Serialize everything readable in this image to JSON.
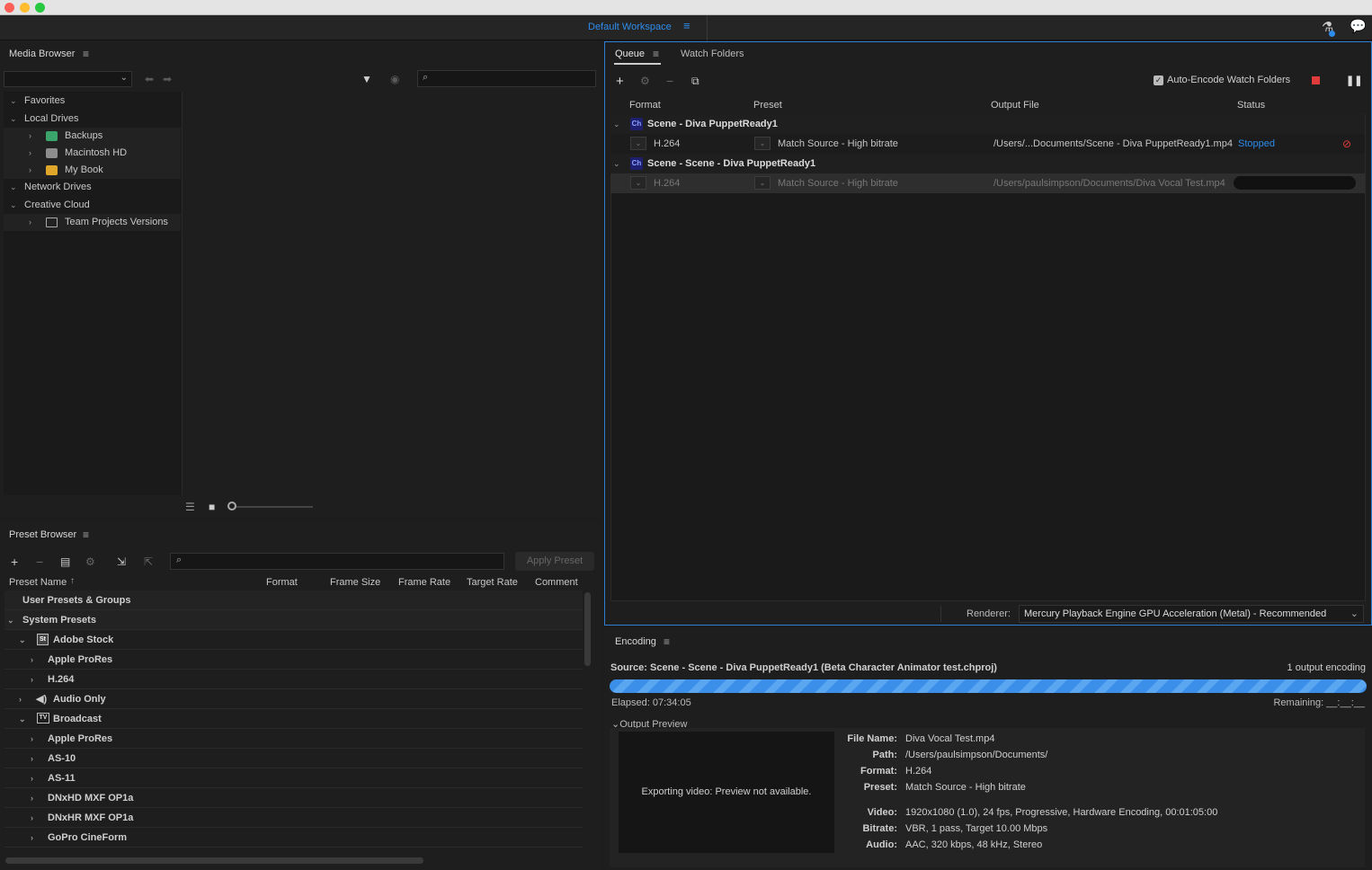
{
  "workspace": {
    "name": "Default Workspace"
  },
  "media_browser": {
    "title": "Media Browser",
    "tree": [
      {
        "label": "Favorites",
        "level": 0
      },
      {
        "label": "Local Drives",
        "level": 0
      },
      {
        "label": "Backups",
        "level": 1,
        "icon": "drive-green-icon"
      },
      {
        "label": "Macintosh HD",
        "level": 1,
        "icon": "drive-gray-icon"
      },
      {
        "label": "My Book",
        "level": 1,
        "icon": "drive-yellow-icon"
      },
      {
        "label": "Network Drives",
        "level": 0
      },
      {
        "label": "Creative Cloud",
        "level": 0
      },
      {
        "label": "Team Projects Versions",
        "level": 1,
        "icon": "team-projects-icon"
      }
    ]
  },
  "preset_browser": {
    "title": "Preset Browser",
    "apply_label": "Apply Preset",
    "columns": [
      "Preset Name",
      "Format",
      "Frame Size",
      "Frame Rate",
      "Target Rate",
      "Comment"
    ],
    "rows": [
      {
        "label": "User Presets & Groups",
        "level": 0,
        "chev": "",
        "icon": ""
      },
      {
        "label": "System Presets",
        "level": 0,
        "chev": "v",
        "icon": ""
      },
      {
        "label": "Adobe Stock",
        "level": 1,
        "chev": "v",
        "icon": "St"
      },
      {
        "label": "Apple ProRes",
        "level": 2,
        "chev": ">",
        "icon": ""
      },
      {
        "label": "H.264",
        "level": 2,
        "chev": ">",
        "icon": ""
      },
      {
        "label": "Audio Only",
        "level": 1,
        "chev": ">",
        "icon": "speaker"
      },
      {
        "label": "Broadcast",
        "level": 1,
        "chev": "v",
        "icon": "TV"
      },
      {
        "label": "Apple ProRes",
        "level": 2,
        "chev": ">",
        "icon": ""
      },
      {
        "label": "AS-10",
        "level": 2,
        "chev": ">",
        "icon": ""
      },
      {
        "label": "AS-11",
        "level": 2,
        "chev": ">",
        "icon": ""
      },
      {
        "label": "DNxHD MXF OP1a",
        "level": 2,
        "chev": ">",
        "icon": ""
      },
      {
        "label": "DNxHR MXF OP1a",
        "level": 2,
        "chev": ">",
        "icon": ""
      },
      {
        "label": "GoPro CineForm",
        "level": 2,
        "chev": ">",
        "icon": ""
      }
    ]
  },
  "queue": {
    "tabs": [
      "Queue",
      "Watch Folders"
    ],
    "auto_encode_label": "Auto-Encode Watch Folders",
    "auto_encode_checked": true,
    "columns": [
      "Format",
      "Preset",
      "Output File",
      "Status"
    ],
    "items": [
      {
        "source": "Scene - Diva PuppetReady1",
        "badge": "Ch",
        "output": {
          "format": "H.264",
          "preset": "Match Source - High bitrate",
          "file": "/Users/...Documents/Scene - Diva PuppetReady1.mp4",
          "status": "Stopped"
        }
      },
      {
        "source": "Scene - Scene - Diva PuppetReady1",
        "badge": "Ch",
        "output": {
          "format": "H.264",
          "preset": "Match Source - High bitrate",
          "file": "/Users/paulsimpson/Documents/Diva Vocal Test.mp4",
          "status": ""
        }
      }
    ],
    "renderer_label": "Renderer:",
    "renderer_value": "Mercury Playback Engine GPU Acceleration (Metal) - Recommended"
  },
  "encoding": {
    "title": "Encoding",
    "source": "Source: Scene - Scene - Diva PuppetReady1 (Beta Character Animator test.chproj)",
    "count": "1 output encoding",
    "elapsed": "Elapsed: 07:34:05",
    "remaining": "Remaining: __:__:__",
    "output_preview_label": "Output Preview",
    "preview_message": "Exporting video: Preview not available.",
    "details": {
      "file_name_label": "File Name:",
      "file_name": "Diva Vocal Test.mp4",
      "path_label": "Path:",
      "path": "/Users/paulsimpson/Documents/",
      "format_label": "Format:",
      "format": "H.264",
      "preset_label": "Preset:",
      "preset": "Match Source - High bitrate",
      "video_label": "Video:",
      "video": "1920x1080 (1.0), 24 fps, Progressive, Hardware Encoding, 00:01:05:00",
      "bitrate_label": "Bitrate:",
      "bitrate": "VBR, 1 pass, Target 10.00 Mbps",
      "audio_label": "Audio:",
      "audio": "AAC, 320 kbps, 48 kHz, Stereo"
    }
  },
  "colors": {
    "accent": "#2d8ceb",
    "progress": "#3b8fe8",
    "stop": "#e03b3b",
    "panel_active_border": "#2d7fd6"
  }
}
